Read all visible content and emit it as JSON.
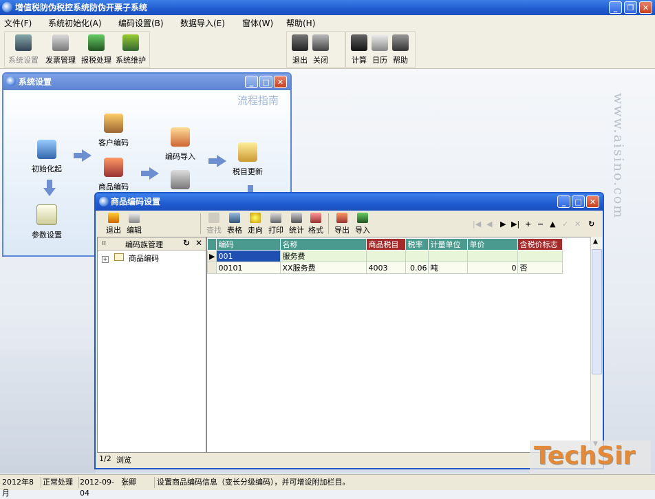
{
  "app": {
    "title": "增值税防伪税控系统防伪开票子系统"
  },
  "menu": [
    "文件(F)",
    "系统初始化(A)",
    "编码设置(B)",
    "数据导入(E)",
    "窗体(W)",
    "帮助(H)"
  ],
  "toolbar": {
    "left": [
      {
        "label": "系统设置",
        "icon": "server-icon"
      },
      {
        "label": "发票管理",
        "icon": "lock-icon"
      },
      {
        "label": "报税处理",
        "icon": "cube-icon"
      },
      {
        "label": "系统维护",
        "icon": "wrench-icon"
      }
    ],
    "middle": [
      {
        "label": "退出",
        "icon": "exit-icon"
      },
      {
        "label": "关闭",
        "icon": "close-icon"
      }
    ],
    "right": [
      {
        "label": "计算",
        "icon": "calculator-icon"
      },
      {
        "label": "日历",
        "icon": "calendar-icon"
      },
      {
        "label": "帮助",
        "icon": "help-icon"
      }
    ]
  },
  "watermark": "www.aisino.com",
  "sys_window": {
    "title": "系统设置",
    "guide": "流程指南",
    "steps": [
      "初始化起",
      "客户编码",
      "商品编码",
      "编码导入",
      "税目更新",
      "参数设置"
    ]
  },
  "prod_window": {
    "title": "商品编码设置",
    "tools": [
      "退出",
      "编辑",
      "查找",
      "表格",
      "走向",
      "打印",
      "统计",
      "格式",
      "导出",
      "导入"
    ],
    "tree_header": "编码族管理",
    "tree_node": "商品编码",
    "columns": [
      "编码",
      "名称",
      "商品税目",
      "税率",
      "计量单位",
      "单价",
      "含税价标志"
    ],
    "rows": [
      [
        "001",
        "服务费",
        "",
        "",
        "",
        "",
        ""
      ],
      [
        "00101",
        "XX服务费",
        "4003",
        "0.06",
        "吨",
        "0",
        "否"
      ]
    ],
    "page": "1/2",
    "mode": "浏览"
  },
  "status": {
    "period": "2012年8月",
    "state": "正常处理",
    "date": "2012-09-04",
    "user": "张卿",
    "message": "设置商品编码信息（变长分级编码），并可增设附加栏目。"
  },
  "logo": "TechSir"
}
